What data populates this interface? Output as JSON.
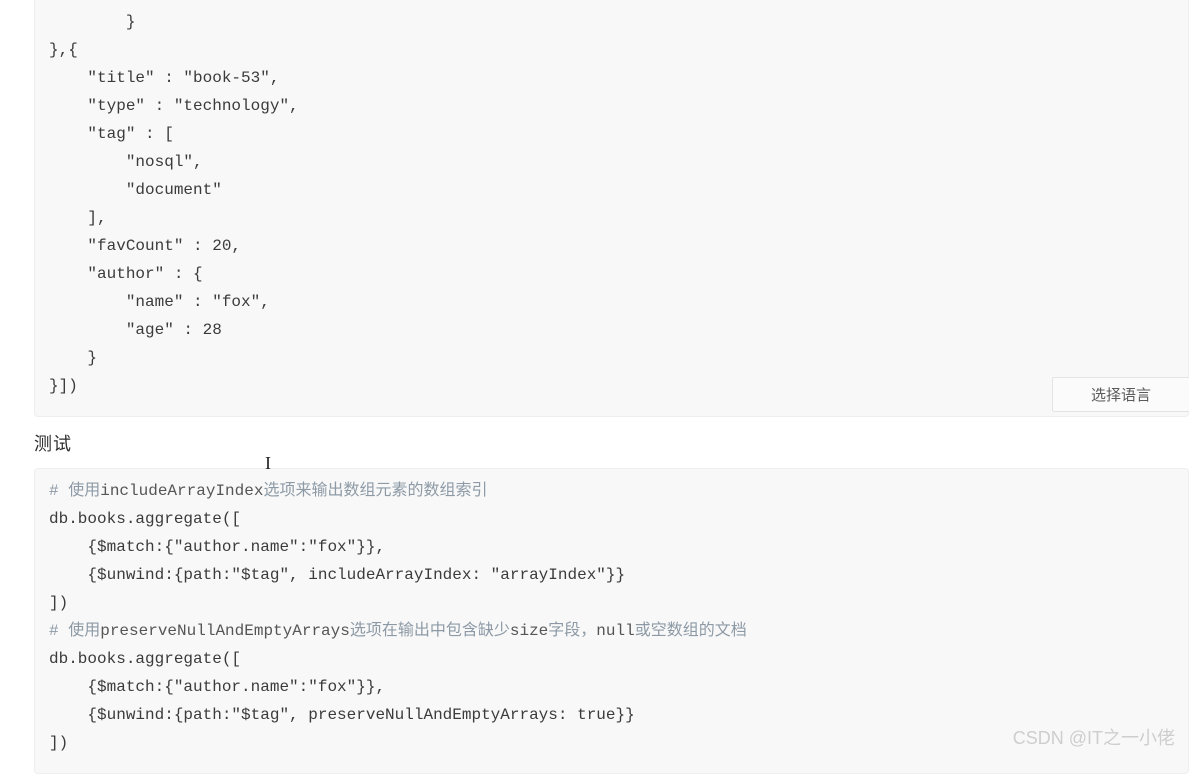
{
  "codeBlock1": {
    "lines": [
      "        }",
      "},{",
      "    \"title\" : \"book-53\",",
      "    \"type\" : \"technology\",",
      "    \"tag\" : [",
      "        \"nosql\",",
      "        \"document\"",
      "    ],",
      "    \"favCount\" : 20,",
      "    \"author\" : {",
      "        \"name\" : \"fox\",",
      "        \"age\" : 28",
      "    }",
      "}])"
    ]
  },
  "sectionTitle": "测试",
  "langSelect": "选择语言",
  "codeBlock2": {
    "comment1_prefix": "# 使用",
    "comment1_kw": "includeArrayIndex",
    "comment1_suffix": "选项来输出数组元素的数组索引",
    "lines1": [
      "db.books.aggregate([",
      "    {$match:{\"author.name\":\"fox\"}},",
      "    {$unwind:{path:\"$tag\", includeArrayIndex: \"arrayIndex\"}}",
      "])"
    ],
    "comment2_prefix": "# 使用",
    "comment2_kw1": "preserveNullAndEmptyArrays",
    "comment2_mid": "选项在输出中包含缺少",
    "comment2_kw2": "size",
    "comment2_mid2": "字段，",
    "comment2_kw3": "null",
    "comment2_suffix": "或空数组的文档",
    "lines2": [
      "db.books.aggregate([",
      "    {$match:{\"author.name\":\"fox\"}},",
      "    {$unwind:{path:\"$tag\", preserveNullAndEmptyArrays: true}}",
      "])"
    ]
  },
  "watermark": "CSDN @IT之一小佬"
}
